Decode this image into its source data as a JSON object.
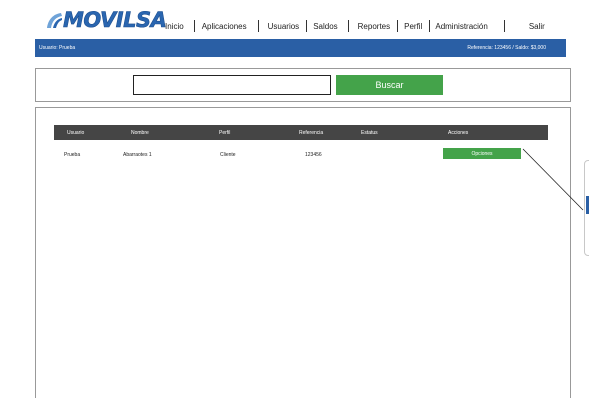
{
  "brand": {
    "logo_text": "MOVILSA",
    "primary_color": "#2a5fa5",
    "button_color": "#44a34a",
    "header_color": "#454545"
  },
  "nav": {
    "items": [
      "Inicio",
      "Aplicaciones",
      "Usuarios",
      "Saldos",
      "Reportes",
      "Perfil",
      "Administración",
      "Salir"
    ]
  },
  "info_bar": {
    "user": "Usuario: Prueba",
    "reference": "Referencia: 123456 / Saldo: $3,000"
  },
  "search": {
    "value": "",
    "placeholder": "",
    "button_label": "Buscar"
  },
  "table": {
    "headers": [
      "Usuario",
      "Nombre",
      "Perfil",
      "Referencia",
      "Estatus",
      "Acciones"
    ],
    "rows": [
      {
        "usuario": "Prueba",
        "nombre": "Abarraotes 1",
        "perfil": "Cliente",
        "referencia": "123456",
        "estatus": "",
        "accion_label": "Opciones"
      }
    ]
  },
  "icons": {
    "logo": "movilsa-logo-icon"
  }
}
